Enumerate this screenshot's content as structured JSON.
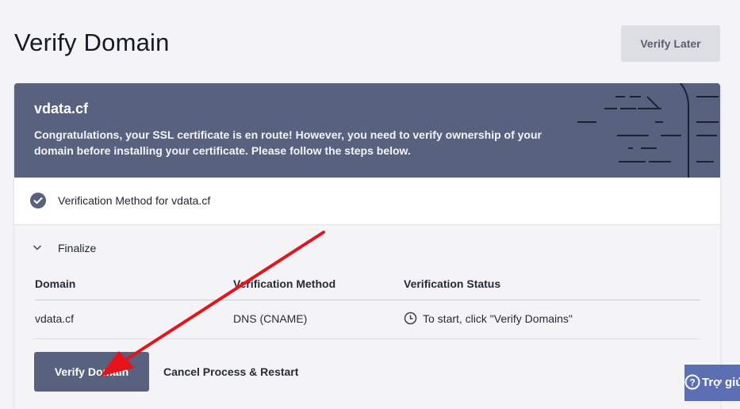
{
  "header": {
    "title": "Verify Domain",
    "verify_later_label": "Verify Later"
  },
  "banner": {
    "domain": "vdata.cf",
    "message": "Congratulations, your SSL certificate is en route! However, you need to verify ownership of your domain before installing your certificate. Please follow the steps below."
  },
  "steps": {
    "method_label": "Verification Method for vdata.cf",
    "method_icon": "check-circle-icon",
    "finalize_label": "Finalize",
    "finalize_icon": "chevron-down-icon"
  },
  "table": {
    "columns": [
      "Domain",
      "Verification Method",
      "Verification Status"
    ],
    "rows": [
      {
        "domain": "vdata.cf",
        "method": "DNS (CNAME)",
        "status": "To start, click \"Verify Domains\"",
        "status_icon": "clock-icon"
      }
    ]
  },
  "actions": {
    "verify_label": "Verify Domain",
    "cancel_label": "Cancel Process & Restart"
  },
  "help": {
    "label": "Trợ giú",
    "icon": "question-circle-icon"
  },
  "annotation": {
    "arrow_color": "#e8131a"
  },
  "colors": {
    "accent": "#58627e",
    "help": "#5c6fb3"
  }
}
